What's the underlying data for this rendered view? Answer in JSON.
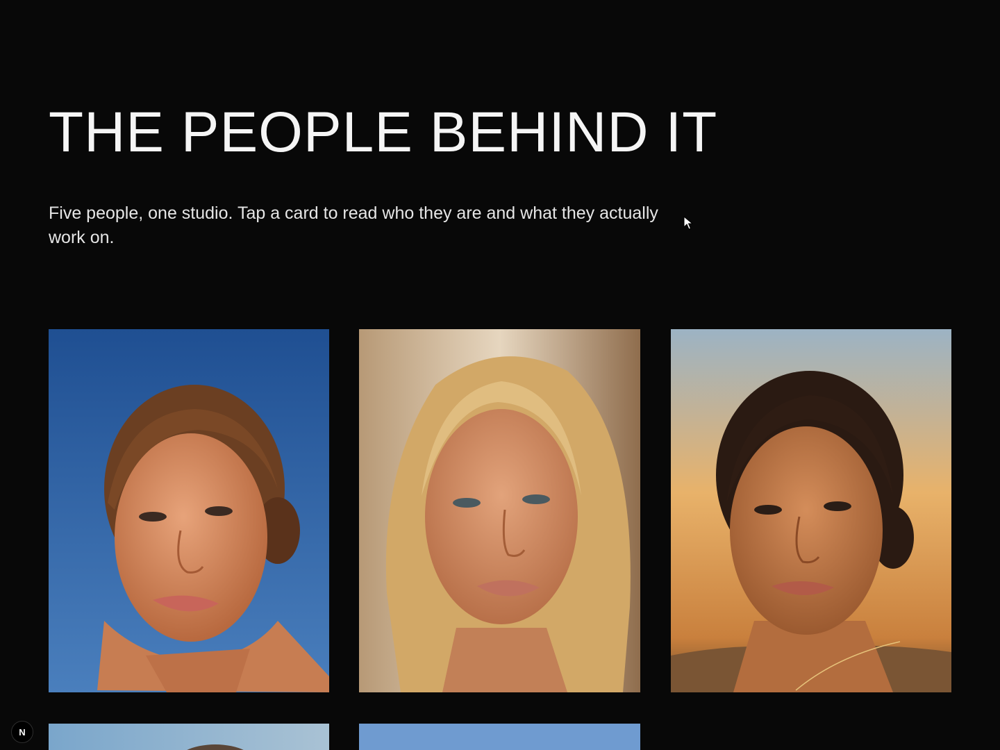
{
  "section": {
    "title": "THE PEOPLE BEHIND IT",
    "subtitle": "Five people, one studio. Tap a card to read who they are and what they actually work on."
  },
  "team_cards": [
    {
      "photo": "portrait-freckled-woman-blue-sky",
      "background_color": "#2c5d9c"
    },
    {
      "photo": "portrait-blonde-woman-warm-wall",
      "background_color": "#c9ab86"
    },
    {
      "photo": "portrait-dark-haired-woman-sunset",
      "background_color": "#d99a52"
    },
    {
      "photo": "portrait-partial-blue-sky",
      "background_color": "#7da3c4"
    },
    {
      "photo": "portrait-partial-blue-sky",
      "background_color": "#6f9bd0"
    }
  ],
  "dev_badge": {
    "label": "N",
    "icon": "nextjs-icon"
  },
  "colors": {
    "background": "#080808",
    "text": "#f5f5f5"
  }
}
